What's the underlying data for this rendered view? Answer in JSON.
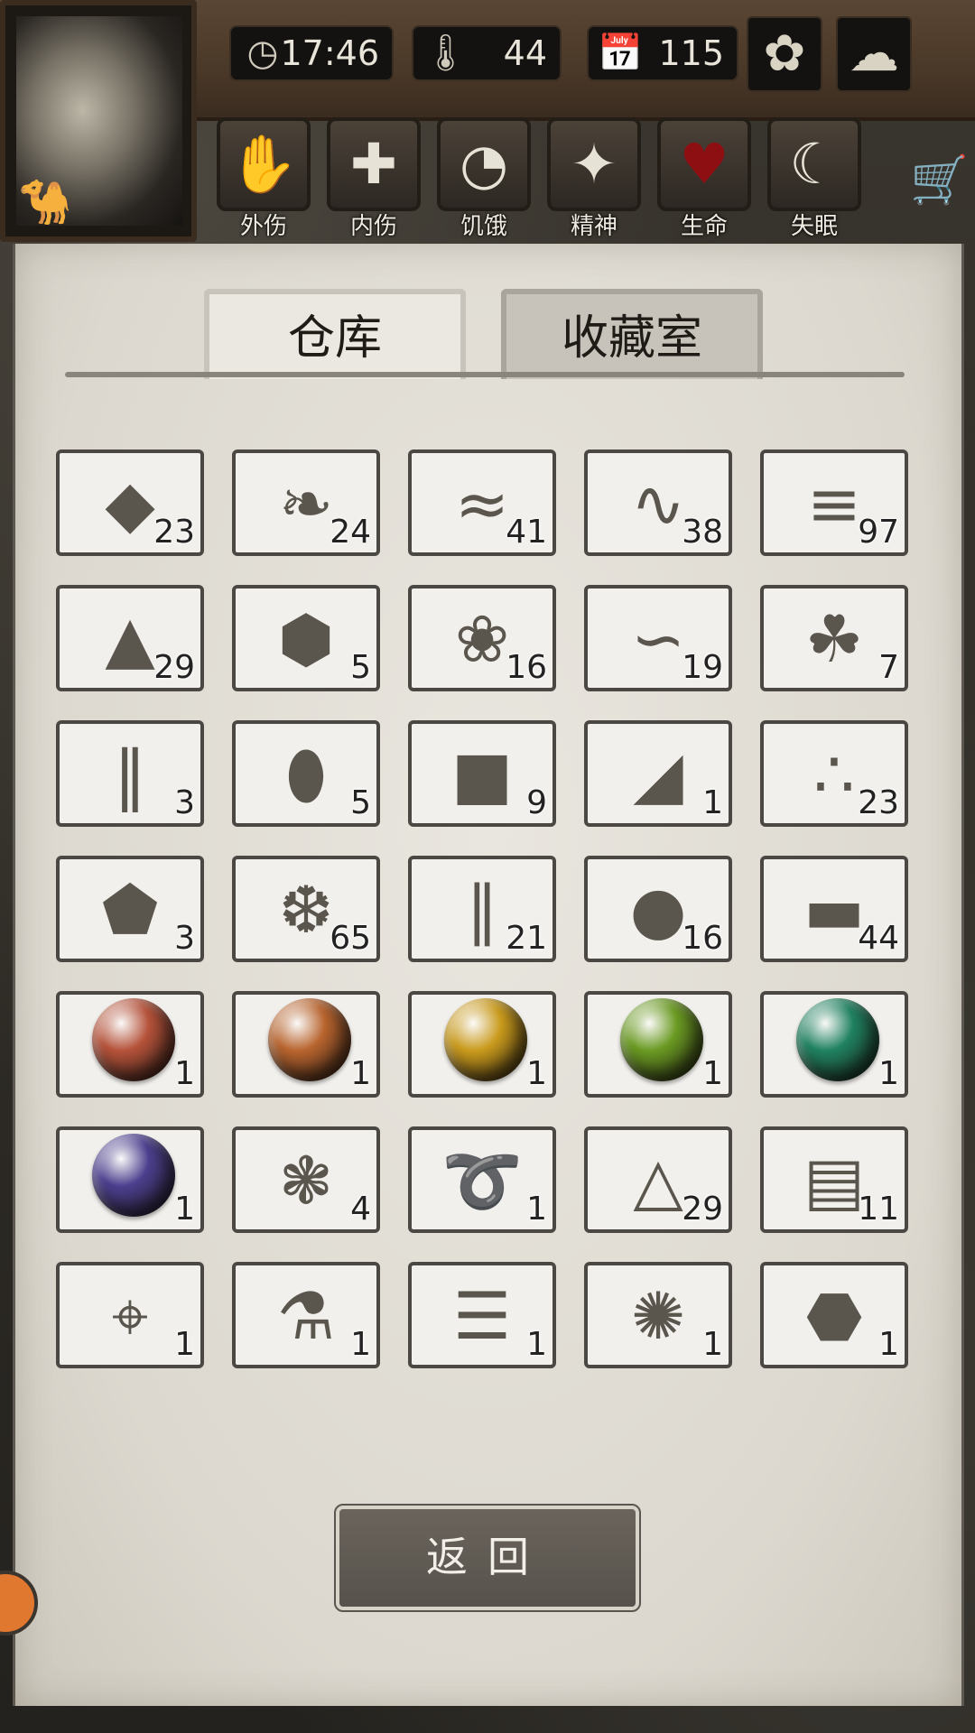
{
  "hud": {
    "time": "17:46",
    "temperature": "44",
    "day": "115",
    "icons": {
      "clock": "clock-icon",
      "thermometer": "thermometer-icon",
      "calendar": "calendar-icon",
      "weather_left": "sunflower-icon",
      "weather_right": "cloud-icon"
    }
  },
  "status": [
    {
      "label": "外伤",
      "icon": "hand-icon"
    },
    {
      "label": "内伤",
      "icon": "cross-icon"
    },
    {
      "label": "饥饿",
      "icon": "stomach-icon"
    },
    {
      "label": "精神",
      "icon": "brain-icon"
    },
    {
      "label": "生命",
      "icon": "heart-icon"
    },
    {
      "label": "失眠",
      "icon": "moon-icon"
    }
  ],
  "tabs": {
    "storage": "仓库",
    "collection": "收藏室"
  },
  "items": [
    {
      "icon": "stone-icon",
      "count": "23"
    },
    {
      "icon": "leaf-icon",
      "count": "24"
    },
    {
      "icon": "water-puddle-icon",
      "count": "41"
    },
    {
      "icon": "vine-icon",
      "count": "38"
    },
    {
      "icon": "planks-icon",
      "count": "97"
    },
    {
      "icon": "flint-icon",
      "count": "29"
    },
    {
      "icon": "ore-icon",
      "count": "5"
    },
    {
      "icon": "animal-hide-icon",
      "count": "16"
    },
    {
      "icon": "worm-icon",
      "count": "19"
    },
    {
      "icon": "herb-icon",
      "count": "7"
    },
    {
      "icon": "bone-pieces-icon",
      "count": "3"
    },
    {
      "icon": "resin-icon",
      "count": "5"
    },
    {
      "icon": "charcoal-icon",
      "count": "9"
    },
    {
      "icon": "soil-icon",
      "count": "1"
    },
    {
      "icon": "gold-nuggets-icon",
      "count": "23"
    },
    {
      "icon": "rock-icon",
      "count": "3"
    },
    {
      "icon": "salt-crystals-icon",
      "count": "65"
    },
    {
      "icon": "bamboo-icon",
      "count": "21"
    },
    {
      "icon": "oil-drop-icon",
      "count": "16"
    },
    {
      "icon": "log-icon",
      "count": "44"
    },
    {
      "icon": "red-orb-icon",
      "count": "1",
      "color": "#b5523a"
    },
    {
      "icon": "orange-orb-icon",
      "count": "1",
      "color": "#b8642e"
    },
    {
      "icon": "yellow-orb-icon",
      "count": "1",
      "color": "#c99a1c"
    },
    {
      "icon": "green-orb-icon",
      "count": "1",
      "color": "#6a9a22"
    },
    {
      "icon": "teal-orb-icon",
      "count": "1",
      "color": "#1f8160"
    },
    {
      "icon": "purple-orb-icon",
      "count": "1",
      "color": "#4b3f8e"
    },
    {
      "icon": "mud-icon",
      "count": "4"
    },
    {
      "icon": "rope-icon",
      "count": "1"
    },
    {
      "icon": "powder-pile-icon",
      "count": "29"
    },
    {
      "icon": "sack-icon",
      "count": "11"
    },
    {
      "icon": "compass-icon",
      "count": "1"
    },
    {
      "icon": "potion-bottle-icon",
      "count": "1"
    },
    {
      "icon": "parchment-icon",
      "count": "1"
    },
    {
      "icon": "hair-ball-icon",
      "count": "1"
    },
    {
      "icon": "quartz-rock-icon",
      "count": "1"
    }
  ],
  "back_button": "返回"
}
